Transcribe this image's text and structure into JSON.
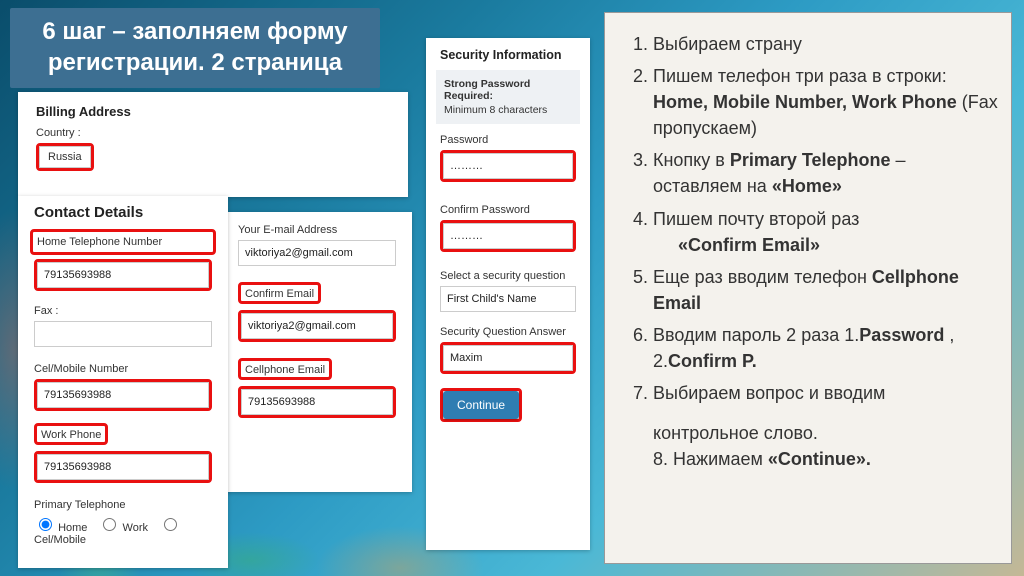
{
  "title": "6 шаг – заполняем форму регистрации. 2 страница",
  "billing": {
    "hdr": "Billing Address",
    "country_label": "Country :",
    "country_value": "Russia"
  },
  "contact": {
    "hdr": "Contact Details",
    "home_label": "Home Telephone Number",
    "home_value": "79135693988",
    "fax_label": "Fax :",
    "fax_value": "",
    "mobile_label": "Cel/Mobile Number",
    "mobile_value": "79135693988",
    "work_label": "Work Phone",
    "work_value": "79135693988",
    "primary_label": "Primary Telephone",
    "radio_home": "Home",
    "radio_work": "Work",
    "radio_mobile": "Cel/Mobile",
    "email_label": "Your E-mail Address",
    "email_value": "viktoriya2@gmail.com",
    "confirm_email_label": "Confirm Email",
    "confirm_email_value": "viktoriya2@gmail.com",
    "cell_email_label": "Cellphone Email",
    "cell_email_value": "79135693988"
  },
  "security": {
    "hdr": "Security Information",
    "hint_title": "Strong Password Required:",
    "hint_body": "Minimum 8 characters",
    "pwd_label": "Password",
    "pwd_value": "………",
    "cpwd_label": "Confirm Password",
    "cpwd_value": "………",
    "question_label": "Select a security question",
    "question_value": "First Child's Name",
    "answer_label": "Security Question Answer",
    "answer_value": "Maxim",
    "continue": "Continue"
  },
  "steps": {
    "s1": "Выбираем  страну",
    "s2a": "Пишем телефон три раза в строки: ",
    "s2b": "Home, Mobile Number, Work Phone",
    "s2c": " (Fax пропускаем)",
    "s3a": "Кнопку в ",
    "s3b": "Primary Telephone",
    "s3c": " – оставляем на ",
    "s3d": "«Home»",
    "s4a": "Пишем  почту второй раз ",
    "s4b": "«Confirm Email»",
    "s5a": "Еще раз вводим телефон ",
    "s5b": "Cellphone Email",
    "s6a": "Вводим пароль 2 раза 1.",
    "s6b": "Password",
    "s6c": " , 2.",
    "s6d": "Confirm P.",
    "s7": "Выбираем  вопрос и вводим",
    "extra1": "контрольное слово.",
    "extra2a": "8. Нажимаем  ",
    "extra2b": "«Continue»."
  }
}
